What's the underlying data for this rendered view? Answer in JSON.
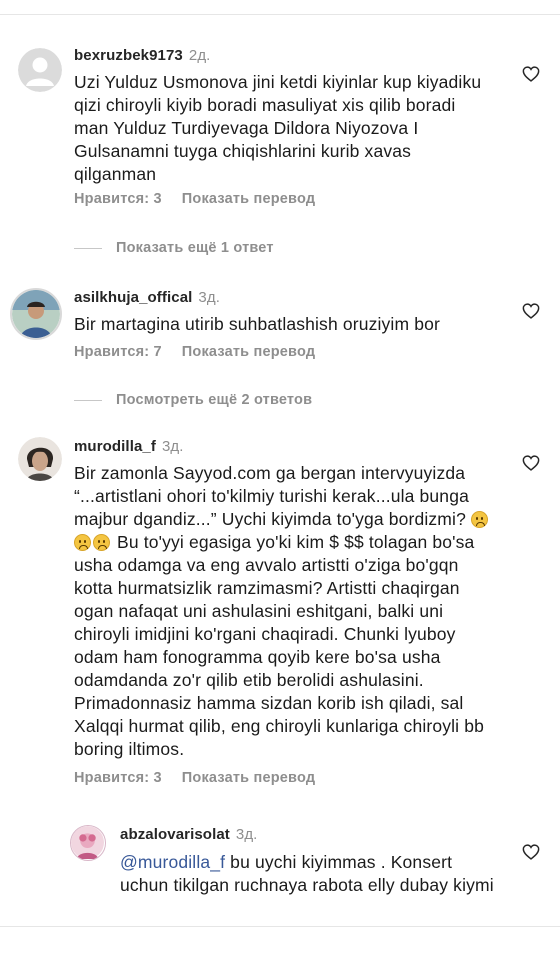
{
  "comments": [
    {
      "username": "bexruzbek9173",
      "time": "2д.",
      "text": "Uzi Yulduz Usmonova jini ketdi kiyinlar kup kiyadiku qizi chiroyli kiyib boradi masuliyat xis qilib boradi man Yulduz Turdiyevaga Dildora Niyozova I Gulsanamni tuyga chiqishlarini kurib xavas qilganman",
      "likes": "Нравится: 3",
      "translate": "Показать перевод",
      "replies": "Показать ещё 1 ответ"
    },
    {
      "username": "asilkhuja_offical",
      "time": "3д.",
      "text": "Bir martagina utirib suhbatlashish oruziyim bor",
      "likes": "Нравится: 7",
      "translate": "Показать перевод",
      "replies": "Посмотреть ещё 2 ответов"
    },
    {
      "username": "murodilla_f",
      "time": "3д.",
      "text_part1": "Bir zamonla Sayyod.com ga bergan intervyuyizda “...artistlani ohori to'kilmiy turishi kerak...ula bunga majbur dgandiz...” Uychi kiyimda to'yga bordizmi?",
      "text_part2": "Bu to'yyi egasiga yo'ki kim $ $$ tolagan bo'sa usha odamga va eng avvalo artistti o'ziga bo'gqn kotta hurmatsizlik ramzimasmi? Artistti chaqirgan ogan nafaqat uni ashulasini eshitgani, balki uni chiroyli imidjini ko'rgani chaqiradi. Chunki lyuboy odam ham fonogramma qoyib kere bo'sa usha odamdanda zo'r qilib etib berolidi ashulasini. Primadonnasiz hamma sizdan korib ish qiladi, sal Xalqqi hurmat qilib, eng chiroyli kunlariga chiroyli bb boring iltimos.",
      "likes": "Нравится: 3",
      "translate": "Показать перевод"
    },
    {
      "username": "abzalovarisolat",
      "time": "3д.",
      "mention": "@murodilla_f",
      "text": " bu uychi kiyimmas . Konsert uchun tikilgan ruchnaya rabota elly dubay kiymi"
    }
  ],
  "icons": {
    "like": "heart-outline-icon",
    "emoji": "frowning-face-emoji"
  },
  "colors": {
    "mention": "#385898",
    "muted": "#8e8e8e"
  }
}
